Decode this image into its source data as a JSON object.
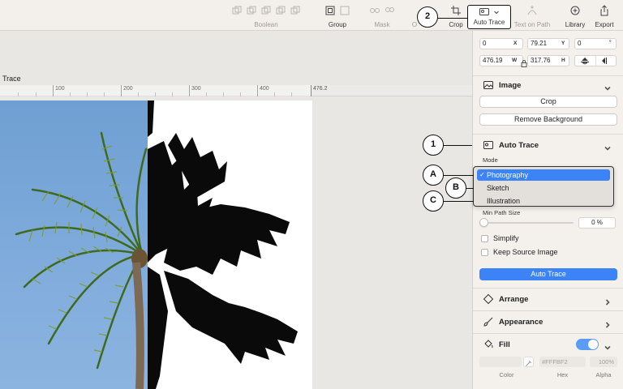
{
  "toolbar": {
    "boolean_label": "Boolean",
    "group_label": "Group",
    "mask_label": "Mask",
    "crop_label": "Crop",
    "auto_trace_label": "Auto Trace",
    "text_on_path_label": "Text on Path",
    "library_label": "Library",
    "export_label": "Export",
    "obscured_label_fragment": "O"
  },
  "document": {
    "title": "Trace"
  },
  "ruler": {
    "ticks": [
      "100",
      "200",
      "300",
      "400"
    ],
    "end_value": "476.2"
  },
  "inspector": {
    "position": {
      "x_value": "0",
      "x_label": "X",
      "y_value": "79.21",
      "y_label": "Y",
      "rotation_value": "0",
      "rotation_unit": "°",
      "w_value": "476.19",
      "w_label": "W",
      "h_value": "317.76",
      "h_label": "H"
    },
    "image_section": {
      "title": "Image",
      "crop_label": "Crop",
      "remove_bg_label": "Remove Background"
    },
    "auto_trace_section": {
      "title": "Auto Trace",
      "mode_label": "Mode",
      "mode_options": [
        "Photography",
        "Sketch",
        "Illustration"
      ],
      "selected_mode": "Photography",
      "min_path_label": "Min Path Size",
      "min_path_value": "0 %",
      "min_path_fraction": 0.0,
      "simplify_label": "Simplify",
      "keep_source_label": "Keep Source Image",
      "action_label": "Auto Trace"
    },
    "arrange_label": "Arrange",
    "appearance_label": "Appearance",
    "fill": {
      "title": "Fill",
      "enabled": true,
      "hex_value": "#FFFBF2",
      "alpha_value": "100%",
      "color_caption": "Color",
      "hex_caption": "Hex",
      "alpha_caption": "Alpha"
    }
  },
  "callouts": {
    "c1": "1",
    "c2": "2",
    "cA": "A",
    "cB": "B",
    "cC": "C"
  },
  "colors": {
    "accent": "#3b83f6",
    "sky": "#7eaadb",
    "panel": "#f4f1ed"
  }
}
